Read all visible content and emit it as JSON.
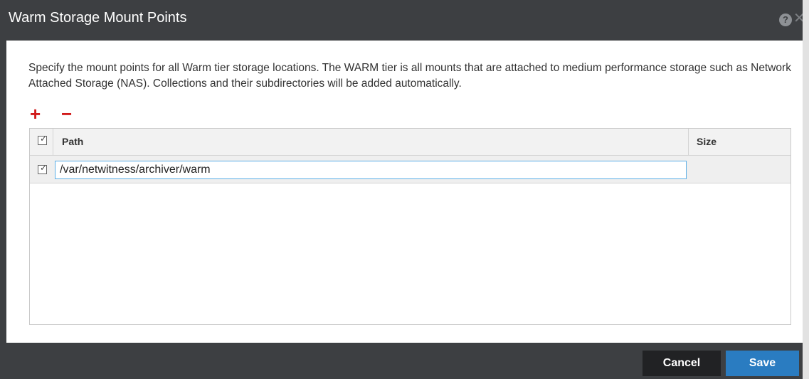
{
  "dialog": {
    "title": "Warm Storage Mount Points",
    "help_icon_glyph": "?",
    "close_icon_glyph": "✕"
  },
  "description": "Specify the mount points for all Warm tier storage locations. The WARM tier is all mounts that are attached to medium performance storage such as Network Attached Storage (NAS). Collections and their subdirectories will be added automatically.",
  "toolbar": {
    "add_icon": "plus-icon",
    "add_glyph": "+",
    "remove_icon": "minus-icon",
    "remove_glyph": "−",
    "icon_color": "#d11a1a"
  },
  "table": {
    "columns": [
      "Path",
      "Size"
    ],
    "select_all_checked": true,
    "rows": [
      {
        "checked": true,
        "path": "/var/netwitness/archiver/warm",
        "size": ""
      }
    ]
  },
  "buttons": {
    "cancel_label": "Cancel",
    "save_label": "Save"
  },
  "colors": {
    "titlebar": "#3d3f42",
    "primary_button": "#2a7cc1",
    "secondary_button": "#212224",
    "input_focus_border": "#5aaee6"
  }
}
